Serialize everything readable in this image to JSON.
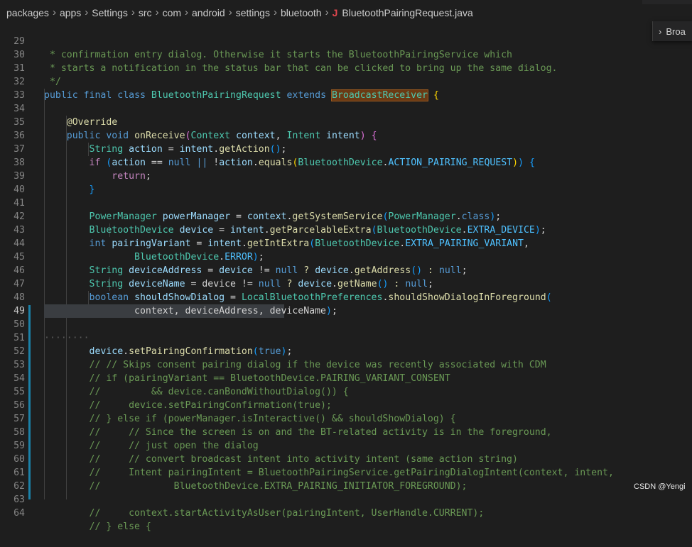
{
  "breadcrumb": {
    "segments": [
      "packages",
      "apps",
      "Settings",
      "src",
      "com",
      "android",
      "settings",
      "bluetooth"
    ],
    "file_icon": "J",
    "file_name": "BluetoothPairingRequest.java"
  },
  "peek": {
    "label": "Broa"
  },
  "watermark": "CSDN @Yengi",
  "line_numbers": [
    "29",
    "30",
    "31",
    "32",
    "33",
    "34",
    "35",
    "36",
    "37",
    "38",
    "39",
    "40",
    "41",
    "42",
    "43",
    "44",
    "45",
    "46",
    "47",
    "48",
    "49",
    "50",
    "51",
    "52",
    "53",
    "54",
    "55",
    "56",
    "57",
    "58",
    "59",
    "60",
    "61",
    "62",
    "63",
    "64"
  ],
  "active_line": "49",
  "colors": {
    "background": "#1e1e1e",
    "keyword": "#569cd6",
    "type": "#4ec9b0",
    "function": "#dcdcaa",
    "variable": "#9cdcfe",
    "comment": "#6a9955",
    "modified_gutter": "#1b81a8"
  },
  "code": {
    "l29": " * confirmation entry dialog. Otherwise it starts the BluetoothPairingService which",
    "l30": " * starts a notification in the status bar that can be clicked to bring up the same dialog.",
    "l31": " */",
    "l32_public": "public",
    "l32_final": "final",
    "l32_class": "class",
    "l32_name": "BluetoothPairingRequest",
    "l32_extends": "extends",
    "l32_super": "BroadcastReceiver",
    "l32_brace": "{",
    "l34_override": "@Override",
    "l35_public": "public",
    "l35_void": "void",
    "l35_fn": "onReceive",
    "l35_t1": "Context",
    "l35_p1": "context",
    "l35_t2": "Intent",
    "l35_p2": "intent",
    "l36_type": "String",
    "l36_var": "action",
    "l36_obj": "intent",
    "l36_fn": "getAction",
    "l37_if": "if",
    "l37_action": "action",
    "l37_null": "null",
    "l37_action2": "action",
    "l37_fn": "equals",
    "l37_cls": "BluetoothDevice",
    "l37_const": "ACTION_PAIRING_REQUEST",
    "l38_return": "return",
    "l41_type": "PowerManager",
    "l41_var": "powerManager",
    "l41_obj": "context",
    "l41_fn": "getSystemService",
    "l41_cls": "PowerManager",
    "l41_class": "class",
    "l42_type": "BluetoothDevice",
    "l42_var": "device",
    "l42_obj": "intent",
    "l42_fn": "getParcelableExtra",
    "l42_cls": "BluetoothDevice",
    "l42_const": "EXTRA_DEVICE",
    "l43_type": "int",
    "l43_var": "pairingVariant",
    "l43_obj": "intent",
    "l43_fn": "getIntExtra",
    "l43_cls": "BluetoothDevice",
    "l43_const": "EXTRA_PAIRING_VARIANT",
    "l44_cls": "BluetoothDevice",
    "l44_const": "ERROR",
    "l45_type": "String",
    "l45_var": "deviceAddress",
    "l45_obj": "device",
    "l45_null": "null",
    "l45_obj2": "device",
    "l45_fn": "getAddress",
    "l45_null2": "null",
    "l46_type": "String",
    "l46_var": "deviceName",
    "l46_obj": "device",
    "l46_null": "null",
    "l46_obj2": "device",
    "l46_fn": "getName",
    "l46_null2": "null",
    "l47_type": "boolean",
    "l47_var": "shouldShowDialog",
    "l47_cls": "LocalBluetoothPreferences",
    "l47_fn": "shouldShowDialogInForeground",
    "l48_args": "context, deviceAddress, deviceName",
    "l50_dots": "········",
    "l50_obj": "device",
    "l50_fn": "setPairingConfirmation",
    "l50_true": "true",
    "l52": "// // Skips consent pairing dialog if the device was recently associated with CDM",
    "l53": "// if (pairingVariant == BluetoothDevice.PAIRING_VARIANT_CONSENT",
    "l54": "//         && device.canBondWithoutDialog()) {",
    "l55": "//     device.setPairingConfirmation(true);",
    "l56": "// } else if (powerManager.isInteractive() && shouldShowDialog) {",
    "l57": "//     // Since the screen is on and the BT-related activity is in the foreground,",
    "l58": "//     // just open the dialog",
    "l59": "//     // convert broadcast intent into activity intent (same action string)",
    "l60": "//     Intent pairingIntent = BluetoothPairingService.getPairingDialogIntent(context, intent,",
    "l61": "//             BluetoothDevice.EXTRA_PAIRING_INITIATOR_FOREGROUND);",
    "l63": "//     context.startActivityAsUser(pairingIntent, UserHandle.CURRENT);",
    "l64": "// } else {"
  }
}
